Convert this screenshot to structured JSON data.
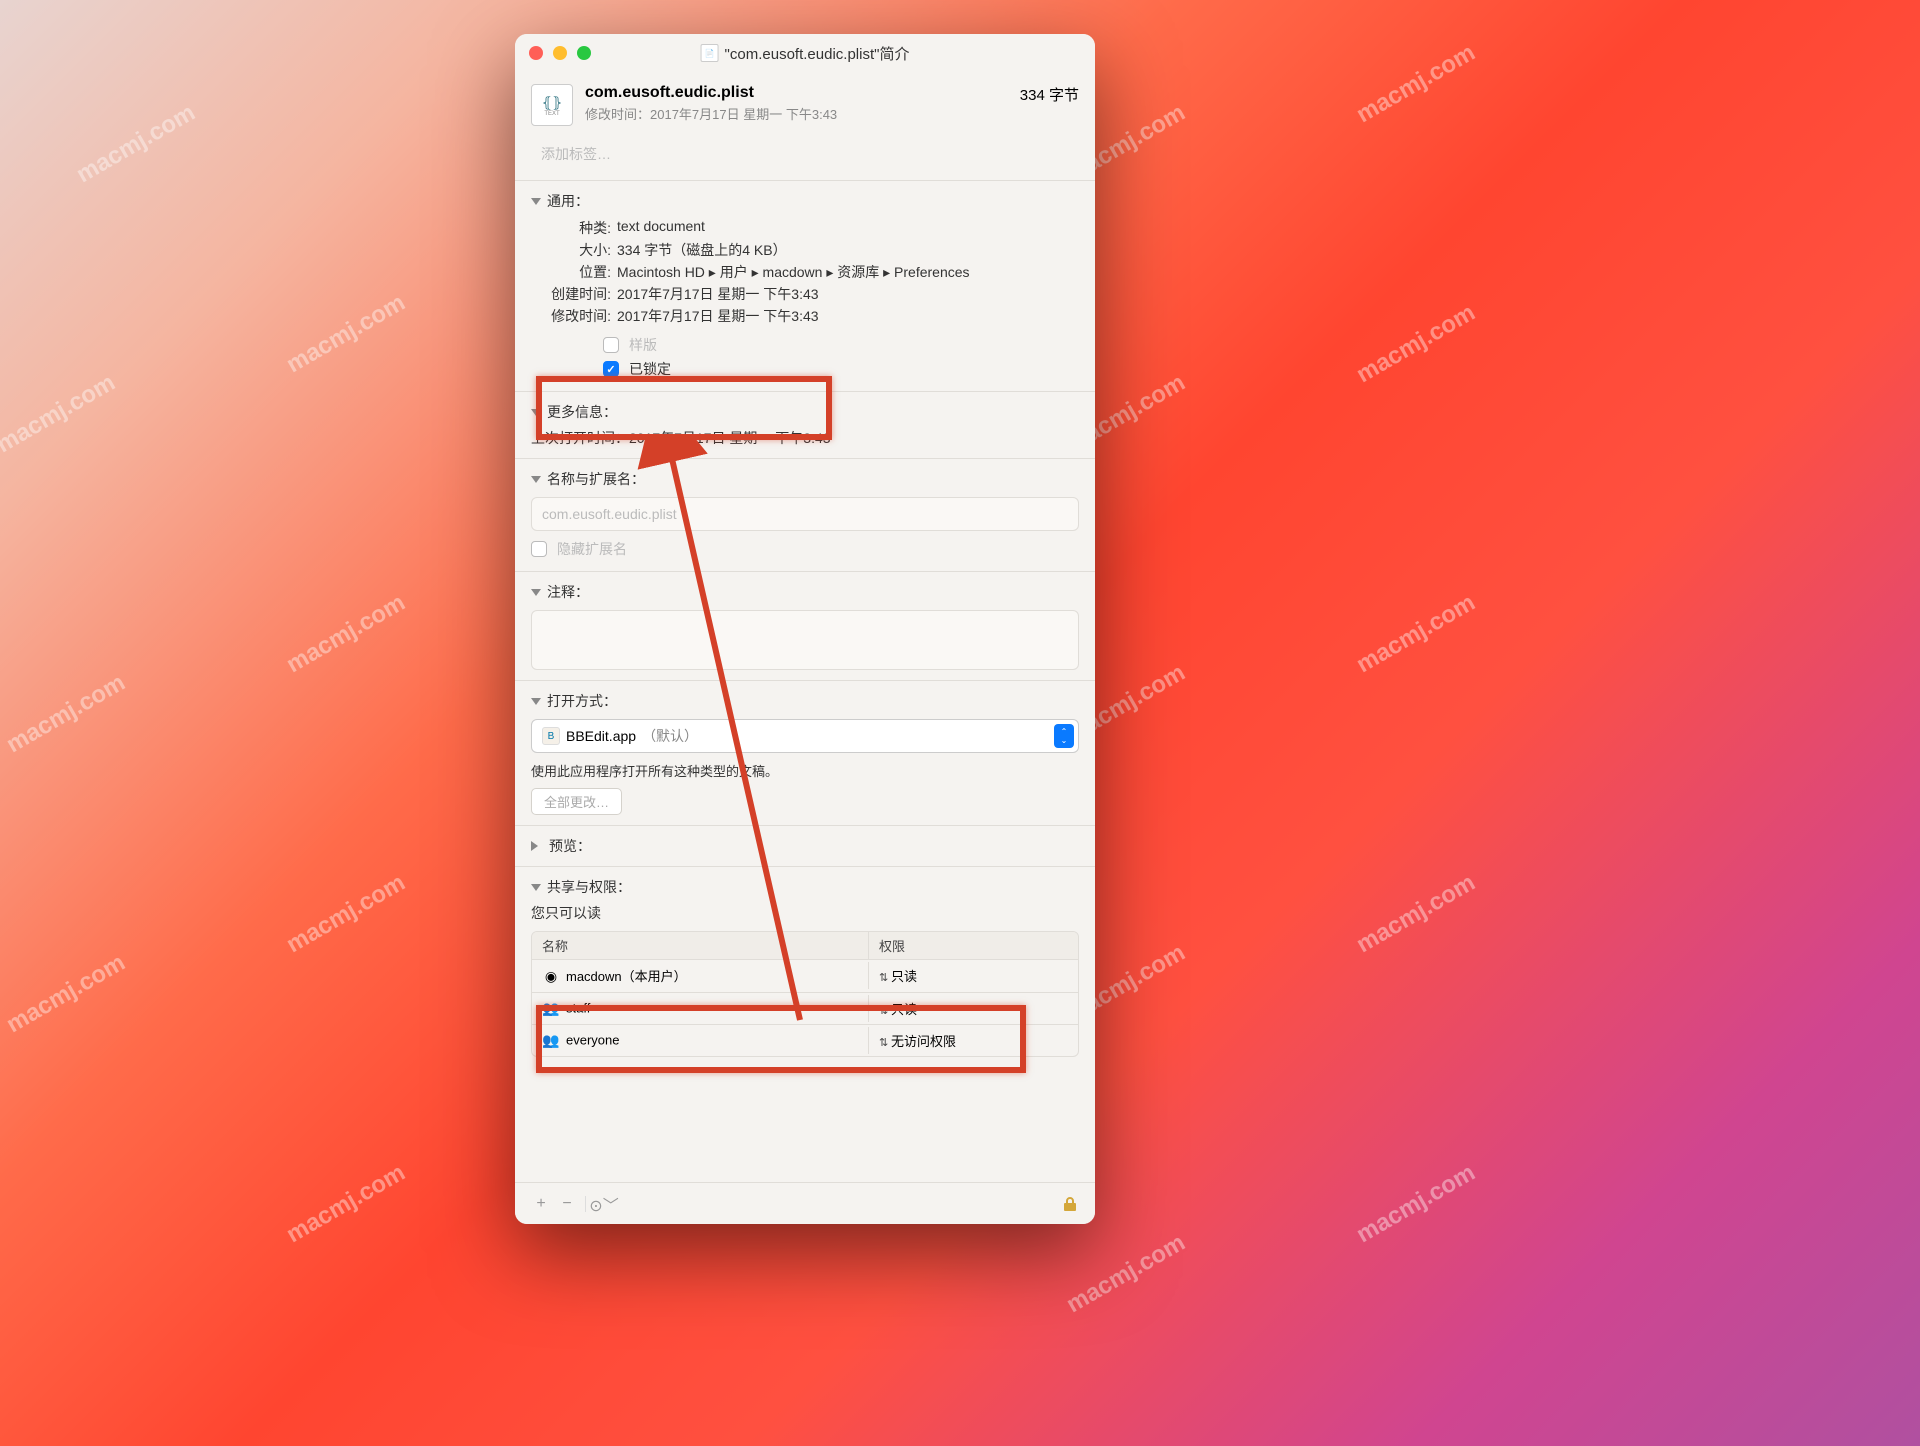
{
  "watermark_text": "macmj.com",
  "window": {
    "title": "\"com.eusoft.eudic.plist\"简介",
    "filename": "com.eusoft.eudic.plist",
    "filesize": "334 字节",
    "modified_label": "修改时间：",
    "modified_value": "2017年7月17日 星期一 下午3:43",
    "tags_placeholder": "添加标签…"
  },
  "general": {
    "header": "通用：",
    "kind_label": "种类",
    "kind_value": "text document",
    "size_label": "大小",
    "size_value": "334 字节（磁盘上的4 KB）",
    "where_label": "位置",
    "where_value": "Macintosh HD ▸ 用户 ▸ macdown ▸ 资源库 ▸ Preferences",
    "created_label": "创建时间",
    "created_value": "2017年7月17日 星期一 下午3:43",
    "modified_label": "修改时间",
    "modified_value": "2017年7月17日 星期一 下午3:43",
    "template_label": "样版",
    "locked_label": "已锁定"
  },
  "more_info": {
    "header": "更多信息：",
    "last_opened_label": "上次打开时间：",
    "last_opened_value": "2017年7月17日 星期一 下午3:43"
  },
  "name_ext": {
    "header": "名称与扩展名：",
    "value": "com.eusoft.eudic.plist",
    "hide_ext_label": "隐藏扩展名"
  },
  "comments": {
    "header": "注释："
  },
  "open_with": {
    "header": "打开方式：",
    "app": "BBEdit.app",
    "default_suffix": "（默认）",
    "note": "使用此应用程序打开所有这种类型的文稿。",
    "change_all": "全部更改…"
  },
  "preview": {
    "header": "预览："
  },
  "sharing": {
    "header": "共享与权限：",
    "note": "您只可以读",
    "col_name": "名称",
    "col_perm": "权限",
    "rows": [
      {
        "name": "macdown（本用户）",
        "perm": "只读",
        "icon": "single"
      },
      {
        "name": "staff",
        "perm": "只读",
        "icon": "group"
      },
      {
        "name": "everyone",
        "perm": "无访问权限",
        "icon": "group"
      }
    ]
  }
}
